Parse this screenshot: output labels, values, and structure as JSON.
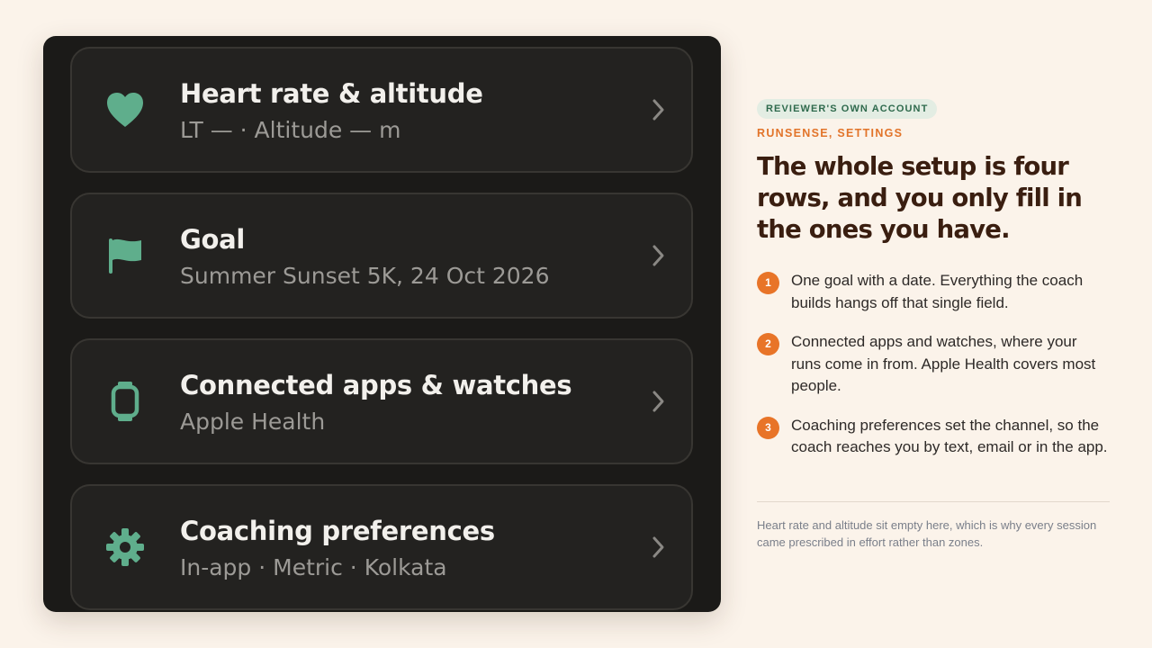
{
  "settings_rows": [
    {
      "icon": "heart-icon",
      "title": "Heart rate & altitude",
      "subtitle": "LT — · Altitude — m"
    },
    {
      "icon": "flag-icon",
      "title": "Goal",
      "subtitle": "Summer Sunset 5K, 24 Oct 2026"
    },
    {
      "icon": "watch-icon",
      "title": "Connected apps & watches",
      "subtitle": "Apple Health"
    },
    {
      "icon": "gear-icon",
      "title": "Coaching preferences",
      "subtitle": "In-app · Metric · Kolkata"
    }
  ],
  "side": {
    "badge": "REVIEWER'S OWN ACCOUNT",
    "kicker": "RUNSENSE, SETTINGS",
    "headline": "The whole setup is four rows, and you only fill in the ones you have.",
    "points": [
      {
        "num": "1",
        "text": "One goal with a date. Everything the coach builds hangs off that single field."
      },
      {
        "num": "2",
        "text": "Connected apps and watches, where your runs come in from. Apple Health covers most people."
      },
      {
        "num": "3",
        "text": "Coaching preferences set the channel, so the coach reaches you by text, email or in the app."
      }
    ],
    "footnote": "Heart rate and altitude sit empty here, which is why every session came prescribed in effort rather than zones."
  },
  "colors": {
    "accent_green": "#5fae8c",
    "accent_orange": "#e87428",
    "background": "#fbf3ea"
  }
}
